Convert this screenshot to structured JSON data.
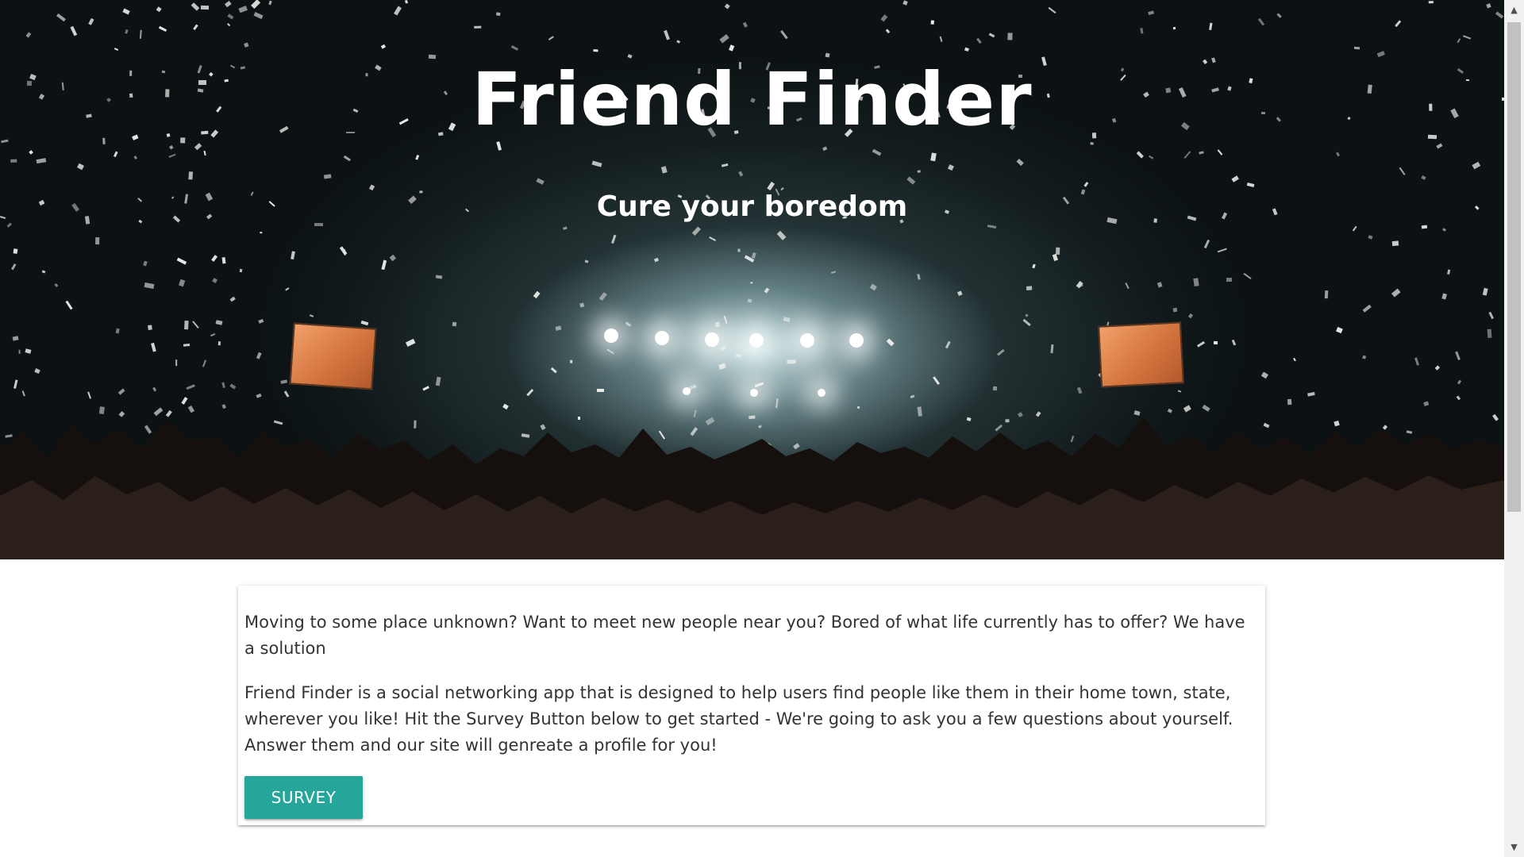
{
  "hero": {
    "title": "Friend Finder",
    "subtitle": "Cure your boredom"
  },
  "card": {
    "paragraph_1": "Moving to some place unknown? Want to meet new people near you? Bored of what life currently has to offer? We have a solution",
    "paragraph_2": "Friend Finder is a social networking app that is designed to help users find people like them in their home town, state, wherever you like! Hit the Survey Button below to get started - We're going to ask you a few questions about yourself. Answer them and our site will genreate a profile for you!",
    "survey_label": "SURVEY"
  },
  "colors": {
    "accent": "#26a69a",
    "text": "#333333"
  },
  "icons": {
    "scroll_up": "scroll-up-arrow-icon",
    "scroll_down": "scroll-down-arrow-icon"
  }
}
